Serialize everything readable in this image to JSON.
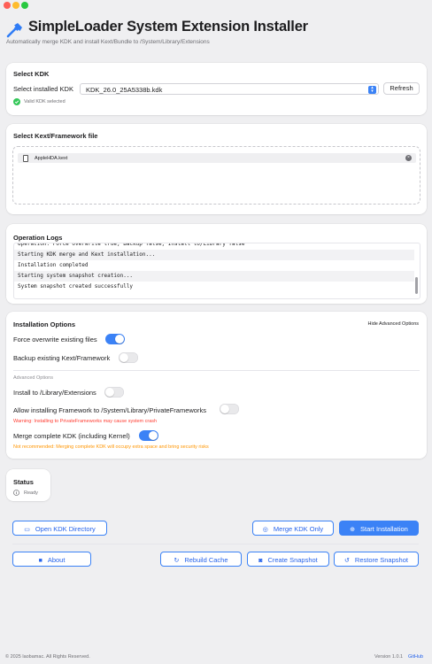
{
  "app": {
    "title": "SimpleLoader System Extension Installer",
    "subtitle": "Automatically merge KDK and install Kext/Bundle to /System/Library/Extensions"
  },
  "kdk": {
    "title": "Select KDK",
    "label": "Select installed KDK",
    "selected": "KDK_26.0_25A5338b.kdk",
    "refresh": "Refresh",
    "status": "Valid KDK selected"
  },
  "kext": {
    "title": "Select Kext/Framework file",
    "files": [
      "AppleHDA.kext"
    ]
  },
  "logs": {
    "title": "Operation Logs",
    "lines": [
      "Operation: Force overwrite true, Backup false, Install to/Library false",
      "Starting KDK merge and Kext installation...",
      "Installation completed",
      "Starting system snapshot creation...",
      "System snapshot created successfully"
    ]
  },
  "options": {
    "title": "Installation Options",
    "toggle_advanced": "Hide Advanced Options",
    "force_overwrite": {
      "label": "Force overwrite existing files",
      "on": true
    },
    "backup": {
      "label": "Backup existing Kext/Framework",
      "on": false
    },
    "advanced_title": "Advanced Options",
    "install_library": {
      "label": "Install to /Library/Extensions",
      "on": false
    },
    "allow_private": {
      "label": "Allow installing Framework to /System/Library/PrivateFrameworks",
      "on": false
    },
    "private_warning": "Warning: Installing to PrivateFrameworks may cause system crash",
    "merge_full": {
      "label": "Merge complete KDK (including Kernel)",
      "on": true
    },
    "merge_warning": "Not recommended: Merging complete KDK will occupy extra space and bring security risks"
  },
  "status": {
    "title": "Status",
    "text": "Ready"
  },
  "actions": {
    "open_kdk": "Open KDK Directory",
    "merge_kdk": "Merge KDK Only",
    "start_install": "Start Installation",
    "about": "About",
    "rebuild_cache": "Rebuild Cache",
    "create_snapshot": "Create Snapshot",
    "restore_snapshot": "Restore Snapshot"
  },
  "footer": {
    "copyright": "© 2025 laobamac. All Rights Reserved.",
    "version": "Version 1.0.1",
    "github": "GitHub"
  },
  "colors": {
    "accent": "#3b82f6",
    "success": "#34c759",
    "warning": "#ff3b30",
    "caution": "#ff9500"
  }
}
